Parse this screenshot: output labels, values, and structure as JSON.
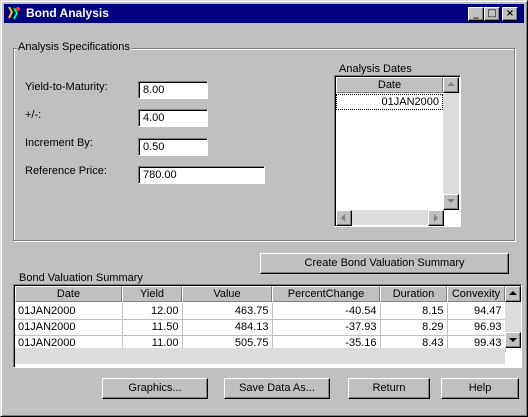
{
  "window": {
    "title": "Bond Analysis",
    "controls": {
      "minimize": "_",
      "maximize": "□",
      "close": "×"
    }
  },
  "specs": {
    "legend": "Analysis Specifications",
    "ytm_label": "Yield-to-Maturity:",
    "ytm_value": "8.00",
    "plusminus_label": "+/-:",
    "plusminus_value": "4.00",
    "increment_label": "Increment  By:",
    "increment_value": "0.50",
    "refprice_label": "Reference Price:",
    "refprice_value": "780.00"
  },
  "dates": {
    "legend": "Analysis Dates",
    "header": "Date",
    "items": [
      "01JAN2000"
    ]
  },
  "create_button": "Create Bond Valuation Summary",
  "summary": {
    "legend": "Bond Valuation Summary",
    "columns": [
      "Date",
      "Yield",
      "Value",
      "PercentChange",
      "Duration",
      "Convexity"
    ],
    "rows": [
      [
        "01JAN2000",
        "12.00",
        "463.75",
        "-40.54",
        "8.15",
        "94.47"
      ],
      [
        "01JAN2000",
        "11.50",
        "484.13",
        "-37.93",
        "8.29",
        "96.93"
      ],
      [
        "01JAN2000",
        "11.00",
        "505.75",
        "-35.16",
        "8.43",
        "99.43"
      ]
    ]
  },
  "footer": {
    "graphics": "Graphics...",
    "save": "Save Data As...",
    "return": "Return",
    "help": "Help"
  },
  "colors": {
    "titlebar": "#000080",
    "face": "#c0c0c0",
    "selection": "#ffffff"
  },
  "icons": {
    "app": "sas-app-icon"
  }
}
